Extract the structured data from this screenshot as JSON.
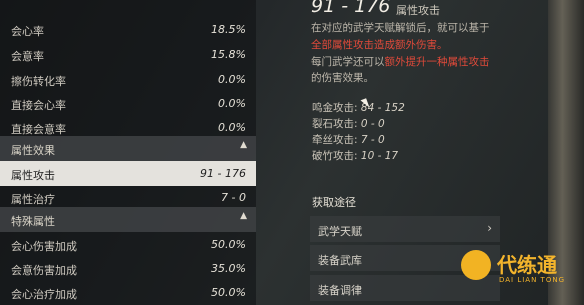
{
  "stats": {
    "rows": [
      {
        "label": "会心率",
        "value": "18.5%"
      },
      {
        "label": "会意率",
        "value": "15.8%"
      },
      {
        "label": "擦伤转化率",
        "value": "0.0%"
      },
      {
        "label": "直接会心率",
        "value": "0.0%"
      },
      {
        "label": "直接会意率",
        "value": "0.0%"
      }
    ],
    "section_attr": "属性效果",
    "attr_rows": [
      {
        "label": "属性攻击",
        "value": "91 - 176"
      },
      {
        "label": "属性治疗",
        "value": "7 - 0"
      }
    ],
    "section_special": "特殊属性",
    "special_rows": [
      {
        "label": "会心伤害加成",
        "value": "50.0%"
      },
      {
        "label": "会意伤害加成",
        "value": "35.0%"
      },
      {
        "label": "会心治疗加成",
        "value": "50.0%"
      }
    ]
  },
  "detail": {
    "title": "91 - 176",
    "subtitle": "属性攻击",
    "desc1": "在对应的武学天赋解锁后，就可以基于",
    "desc2_hl": "全部属性攻击造成额外伤害。",
    "desc3_pre": "每门武学还可以",
    "desc3_hl": "额外提升一种属性攻击",
    "desc4": "的伤害效果。",
    "attrs": [
      {
        "label": "鸣金攻击:",
        "value": "84 - 152"
      },
      {
        "label": "裂石攻击:",
        "value": "0 - 0"
      },
      {
        "label": "牵丝攻击:",
        "value": "7 - 0"
      },
      {
        "label": "破竹攻击:",
        "value": "10 - 17"
      }
    ],
    "acquire_title": "获取途径",
    "buttons": [
      "武学天赋",
      "装备武库",
      "装备调律"
    ]
  },
  "watermark": {
    "name": "代练通",
    "sub": "DAI LIAN TONG"
  },
  "colors": {
    "highlight": "#e14a3a",
    "selected_row": "#e4e2dd",
    "logo": "#f2b323"
  }
}
